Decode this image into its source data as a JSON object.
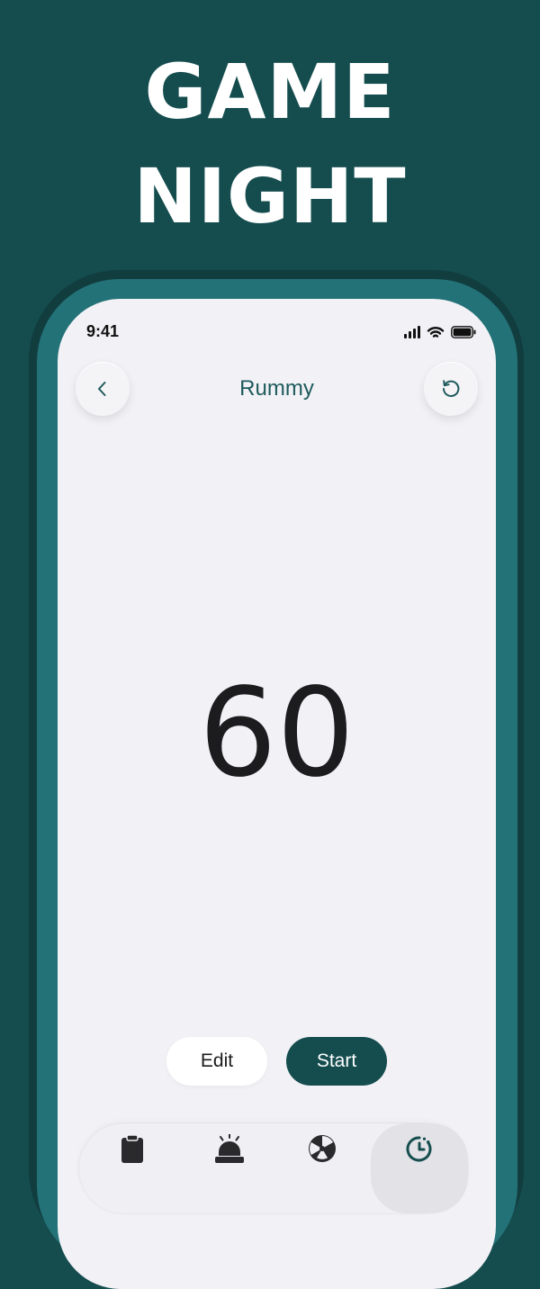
{
  "headline": {
    "line1": "GAME",
    "line2": "NIGHT"
  },
  "status_bar": {
    "time": "9:41",
    "icons": [
      "cellular-signal-icon",
      "wifi-icon",
      "battery-icon"
    ]
  },
  "header": {
    "title": "Rummy",
    "back_icon": "chevron-left-icon",
    "reset_icon": "rotate-ccw-icon"
  },
  "timer": {
    "value": "60"
  },
  "actions": {
    "edit_label": "Edit",
    "start_label": "Start"
  },
  "tab_bar": {
    "tabs": [
      {
        "icon": "clipboard-icon",
        "active": false
      },
      {
        "icon": "buzzer-icon",
        "active": false
      },
      {
        "icon": "spinner-icon",
        "active": false
      },
      {
        "icon": "timer-icon",
        "active": true
      }
    ]
  },
  "colors": {
    "background": "#154d4f",
    "phone_frame": "#237278",
    "screen": "#f2f2f6",
    "accent": "#154d4f",
    "title_text": "#1e5a5c"
  }
}
